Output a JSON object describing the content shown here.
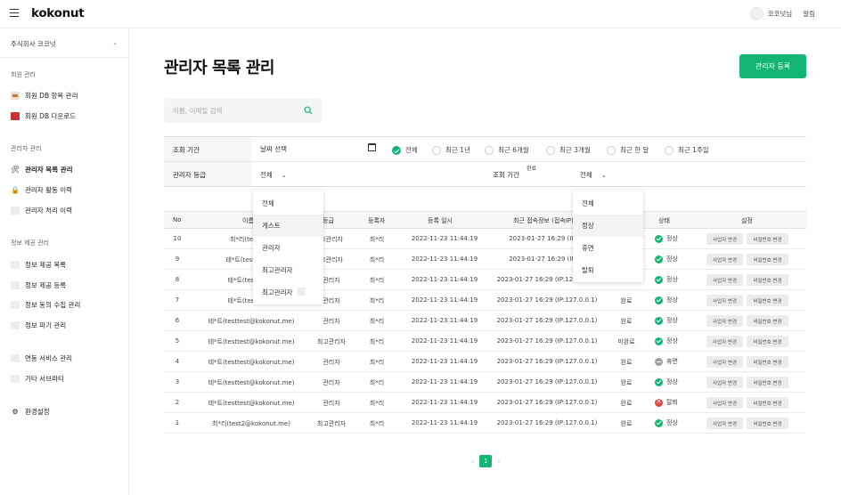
{
  "app": {
    "logo": "kokonut",
    "user": "코코넛님",
    "alarm": "알림"
  },
  "sidebar": {
    "company": "주식회사 코코넛",
    "sections": [
      {
        "label": "회원 관리",
        "items": [
          "회원 DB 항목 관리",
          "회원 DB 다운로드"
        ]
      },
      {
        "label": "관리자 관리",
        "items": [
          "관리자 목록 관리",
          "관리자 활동 이력",
          "관리자 처리 이력"
        ]
      },
      {
        "label": "정보 제공 관리",
        "items": [
          "정보 제공 목록",
          "정보 제공 등록",
          "정보 동의 수집 관리",
          "정보 파기 관리"
        ]
      },
      {
        "label": "",
        "items": [
          "연동 서비스 관리",
          "기타 서브파티"
        ]
      },
      {
        "label": "",
        "items": [
          "환경설정"
        ]
      }
    ]
  },
  "page": {
    "title": "관리자 목록 관리",
    "register_button": "관리자 등록"
  },
  "search": {
    "placeholder": "이름, 이메일 검색"
  },
  "filter": {
    "period_label": "조회 기간",
    "date_placeholder": "날짜 선택",
    "radios": [
      "전체",
      "최근 1년",
      "최근 6개월",
      "최근 3개월",
      "최근 한 달",
      "최근 1주일"
    ],
    "grade_label": "관리자 등급",
    "grade_value": "전체",
    "period2_label": "조회 기간",
    "complete_tag": "완료",
    "period2_value": "전체"
  },
  "grade_dropdown": [
    "전체",
    "게스트",
    "관리자",
    "최고관리자",
    "최고관리자"
  ],
  "status_dropdown": [
    "전체",
    "정상",
    "휴면",
    "탈퇴"
  ],
  "table": {
    "headers": [
      "No",
      "이름",
      "등급",
      "등록자",
      "등록 일시",
      "최근 접속정보 (접속IP)",
      "",
      "상태",
      "설정"
    ],
    "buttons": {
      "business": "사업자 변경",
      "password": "비밀번호 변경"
    },
    "rows": [
      {
        "no": "10",
        "name": "최*리(test2@k",
        "grade": "고관리자",
        "reg": "최*리",
        "date": "2022-11-23 11:44:19",
        "login": "2023-01-27 16:29 (IP:12",
        "done": "",
        "status": "정상",
        "st": "ok"
      },
      {
        "no": "9",
        "name": "테*트(testtest@k",
        "grade": "고관리자",
        "reg": "최*리",
        "date": "2022-11-23 11:44:19",
        "login": "2023-01-27 16:29 (IP:12",
        "done": "",
        "status": "정상",
        "st": "ok"
      },
      {
        "no": "8",
        "name": "테*트(testtest@",
        "grade": "관리자",
        "reg": "최*리",
        "date": "2022-11-23 11:44:19",
        "login": "2023-01-27 16:29 (IP:127.0.0.1)",
        "done": "",
        "status": "정상",
        "st": "ok"
      },
      {
        "no": "7",
        "name": "테*트(testtest@",
        "grade": "관리자",
        "reg": "최*리",
        "date": "2022-11-23 11:44:19",
        "login": "2023-01-27 16:29 (IP:127.0.0.1)",
        "done": "완료",
        "status": "정상",
        "st": "ok"
      },
      {
        "no": "6",
        "name": "테*트(testtest@kokonut.me)",
        "grade": "관리자",
        "reg": "최*리",
        "date": "2022-11-23 11:44:19",
        "login": "2023-01-27 16:29 (IP:127.0.0.1)",
        "done": "완료",
        "status": "정상",
        "st": "ok"
      },
      {
        "no": "5",
        "name": "테*트(testtest@kokonut.me)",
        "grade": "최고관리자",
        "reg": "최*리",
        "date": "2022-11-23 11:44:19",
        "login": "2023-01-27 16:29 (IP:127.0.0.1)",
        "done": "미완료",
        "status": "정상",
        "st": "ok"
      },
      {
        "no": "4",
        "name": "테*트(testtest@kokonut.me)",
        "grade": "관리자",
        "reg": "최*리",
        "date": "2022-11-23 11:44:19",
        "login": "2023-01-27 16:29 (IP:127.0.0.1)",
        "done": "완료",
        "status": "휴면",
        "st": "dormant"
      },
      {
        "no": "3",
        "name": "테*트(testtest@kokonut.me)",
        "grade": "관리자",
        "reg": "최*리",
        "date": "2022-11-23 11:44:19",
        "login": "2023-01-27 16:29 (IP:127.0.0.1)",
        "done": "완료",
        "status": "정상",
        "st": "ok"
      },
      {
        "no": "2",
        "name": "테*트(testtest@kokonut.me)",
        "grade": "관리자",
        "reg": "최*리",
        "date": "2022-11-23 11:44:19",
        "login": "2023-01-27 16:29 (IP:127.0.0.1)",
        "done": "완료",
        "status": "탈퇴",
        "st": "withdraw"
      },
      {
        "no": "1",
        "name": "최*리(test2@kokonut.me)",
        "grade": "최고관리자",
        "reg": "최*리",
        "date": "2022-11-23 11:44:19",
        "login": "2023-01-27 16:29 (IP:127.0.0.1)",
        "done": "완료",
        "status": "정상",
        "st": "ok"
      }
    ]
  },
  "pagination": {
    "current": "1",
    "prev": "‹",
    "next": "›"
  },
  "colors": {
    "accent": "#14b474",
    "withdraw": "#e04646",
    "dormant": "#9aa0a6"
  }
}
